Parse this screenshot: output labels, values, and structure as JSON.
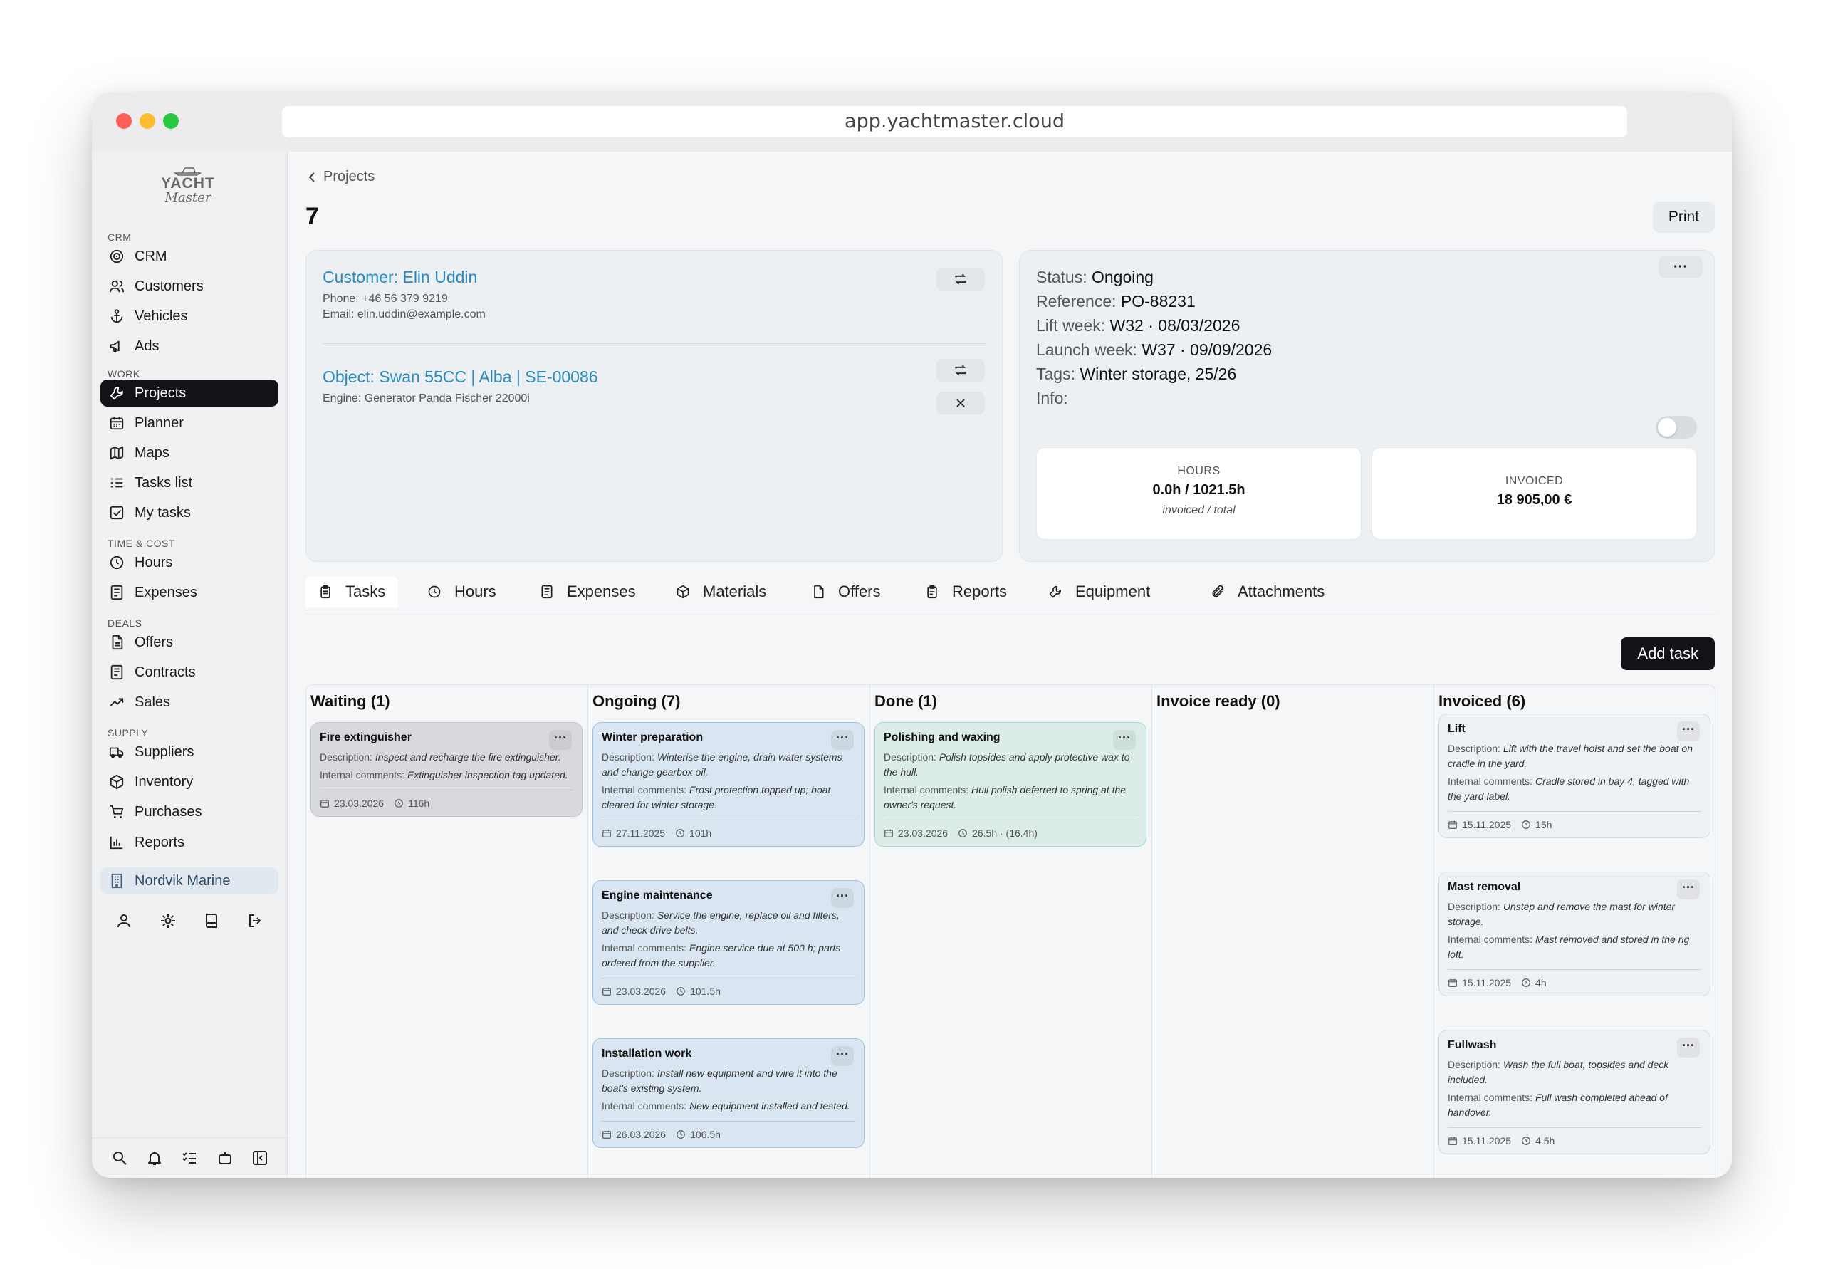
{
  "browser": {
    "url": "app.yachtmaster.cloud"
  },
  "brand": {
    "line1": "YACHT",
    "line2": "Master"
  },
  "sidebar": {
    "sections": [
      {
        "label": "CRM",
        "items": [
          {
            "label": "CRM",
            "icon": "target-icon"
          },
          {
            "label": "Customers",
            "icon": "users-icon"
          },
          {
            "label": "Vehicles",
            "icon": "anchor-icon"
          },
          {
            "label": "Ads",
            "icon": "megaphone-icon"
          }
        ]
      },
      {
        "label": "WORK",
        "items": [
          {
            "label": "Projects",
            "icon": "wrench-icon"
          },
          {
            "label": "Planner",
            "icon": "calendar-icon"
          },
          {
            "label": "Maps",
            "icon": "map-icon"
          },
          {
            "label": "Tasks list",
            "icon": "list-icon"
          },
          {
            "label": "My tasks",
            "icon": "checkbox-icon"
          }
        ]
      },
      {
        "label": "TIME & COST",
        "items": [
          {
            "label": "Hours",
            "icon": "clock-icon"
          },
          {
            "label": "Expenses",
            "icon": "receipt-icon"
          }
        ]
      },
      {
        "label": "DEALS",
        "items": [
          {
            "label": "Offers",
            "icon": "document-icon"
          },
          {
            "label": "Contracts",
            "icon": "contract-icon"
          },
          {
            "label": "Sales",
            "icon": "trend-icon"
          }
        ]
      },
      {
        "label": "SUPPLY",
        "items": [
          {
            "label": "Suppliers",
            "icon": "truck-icon"
          },
          {
            "label": "Inventory",
            "icon": "box-icon"
          },
          {
            "label": "Purchases",
            "icon": "cart-icon"
          },
          {
            "label": "Reports",
            "icon": "bar-chart-icon"
          }
        ]
      }
    ],
    "active": "Projects",
    "organization": "Nordvik Marine"
  },
  "header": {
    "breadcrumb": "Projects",
    "title": "7",
    "print_label": "Print"
  },
  "customer": {
    "name": "Customer: Elin Uddin",
    "phone": "Phone: +46 56 379 9219",
    "email": "Email: elin.uddin@example.com",
    "object": "Object: Swan 55CC | Alba | SE-00086",
    "engine": "Engine: Generator Panda Fischer 22000i"
  },
  "details": {
    "status_label": "Status:",
    "status": "Ongoing",
    "reference_label": "Reference:",
    "reference": "PO-88231",
    "lift_label": "Lift week:",
    "lift": "W32 · 08/03/2026",
    "launch_label": "Launch week:",
    "launch": "W37 · 09/09/2026",
    "tags_label": "Tags:",
    "tags": "Winter storage, 25/26",
    "info_label": "Info:",
    "hours": {
      "label": "HOURS",
      "value": "0.0h / 1021.5h",
      "sub": "invoiced / total"
    },
    "invoiced": {
      "label": "INVOICED",
      "value": "18 905,00 €"
    }
  },
  "tabs": [
    "Tasks",
    "Hours",
    "Expenses",
    "Materials",
    "Offers",
    "Reports",
    "Equipment",
    "Attachments"
  ],
  "add_task_label": "Add task",
  "board": {
    "desc_label": "Description:",
    "comments_label": "Internal comments:",
    "columns": [
      {
        "title": "Waiting (1)",
        "cards": [
          {
            "title": "Fire extinguisher",
            "desc": "Inspect and recharge the fire extinguisher.",
            "comments": "Extinguisher inspection tag updated.",
            "date": "23.03.2026",
            "hours": "116h"
          }
        ]
      },
      {
        "title": "Ongoing (7)",
        "cards": [
          {
            "title": "Winter preparation",
            "desc": "Winterise the engine, drain water systems and change gearbox oil.",
            "comments": "Frost protection topped up; boat cleared for winter storage.",
            "date": "27.11.2025",
            "hours": "101h"
          },
          {
            "title": "Engine maintenance",
            "desc": "Service the engine, replace oil and filters, and check drive belts.",
            "comments": "Engine service due at 500 h; parts ordered from the supplier.",
            "date": "23.03.2026",
            "hours": "101.5h"
          },
          {
            "title": "Installation work",
            "desc": "Install new equipment and wire it into the boat's existing system.",
            "comments": "New equipment installed and tested.",
            "date": "26.03.2026",
            "hours": "106.5h"
          }
        ]
      },
      {
        "title": "Done (1)",
        "cards": [
          {
            "title": "Polishing and waxing",
            "desc": "Polish topsides and apply protective wax to the hull.",
            "comments": "Hull polish deferred to spring at the owner's request.",
            "date": "23.03.2026",
            "hours": "26.5h · (16.4h)"
          }
        ]
      },
      {
        "title": "Invoice ready (0)",
        "cards": []
      },
      {
        "title": "Invoiced (6)",
        "cards": [
          {
            "title": "Lift",
            "desc": "Lift with the travel hoist and set the boat on cradle in the yard.",
            "comments": "Cradle stored in bay 4, tagged with the yard label.",
            "date": "15.11.2025",
            "hours": "15h"
          },
          {
            "title": "Mast removal",
            "desc": "Unstep and remove the mast for winter storage.",
            "comments": "Mast removed and stored in the rig loft.",
            "date": "15.11.2025",
            "hours": "4h"
          },
          {
            "title": "Fullwash",
            "desc": "Wash the full boat, topsides and deck included.",
            "comments": "Full wash completed ahead of handover.",
            "date": "15.11.2025",
            "hours": "4.5h"
          }
        ]
      }
    ]
  },
  "colors": {
    "accent_link": "#2a8bc4",
    "active_nav": "#111317",
    "waiting": "#d7d9dc",
    "ongoing": "#d9e5f0",
    "done": "#dcede9"
  }
}
